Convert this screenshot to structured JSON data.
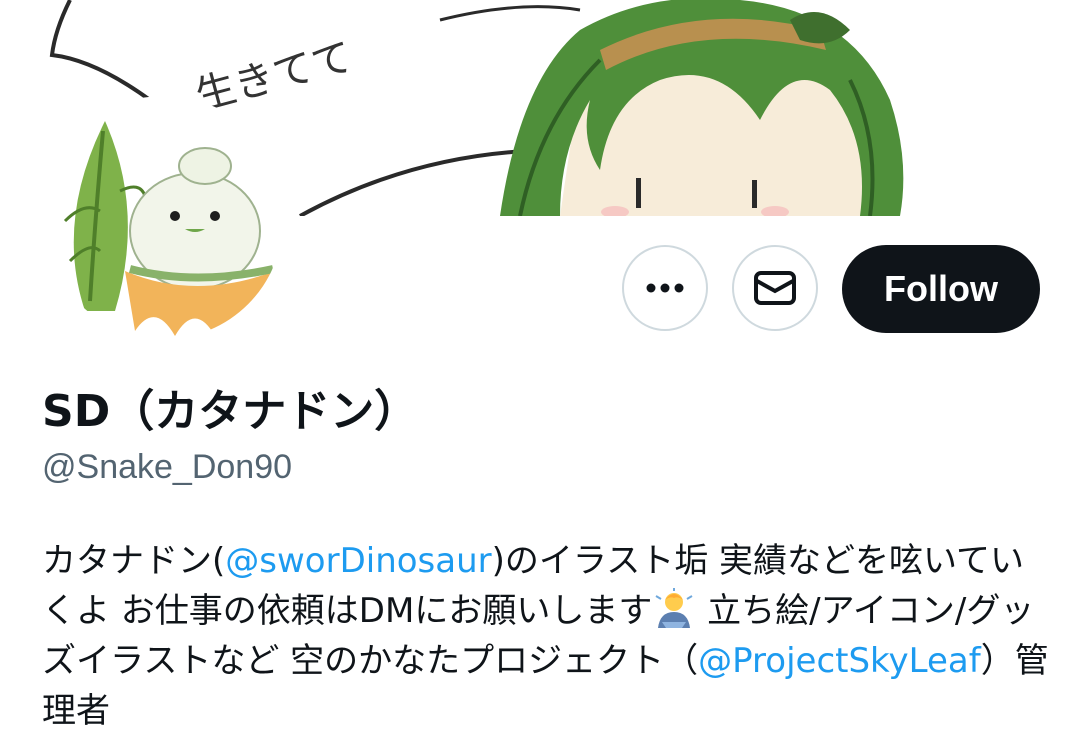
{
  "profile": {
    "display_name": "SD（カタナドン）",
    "handle": "@Snake_Don90"
  },
  "actions": {
    "more_icon": "more-horizontal-icon",
    "message_icon": "envelope-icon",
    "follow_label": "Follow"
  },
  "banner": {
    "speech_text": "生きてて"
  },
  "bio": {
    "part1": "カタナドン(",
    "mention1": "@sworDinosaur",
    "part2": ")のイラスト垢 実績などを呟いていくよ お仕事の依頼はDMにお願いします",
    "emoji": "person-bowing-emoji",
    "part3": " 立ち絵/アイコン/グッズイラストなど 空のかなたプロジェクト（",
    "mention2": "@ProjectSkyLeaf",
    "part4": "）管理者"
  },
  "colors": {
    "link": "#1d9bf0",
    "follow_bg": "#0f1419",
    "secondary_text": "#536471",
    "border": "#cfd9de"
  }
}
